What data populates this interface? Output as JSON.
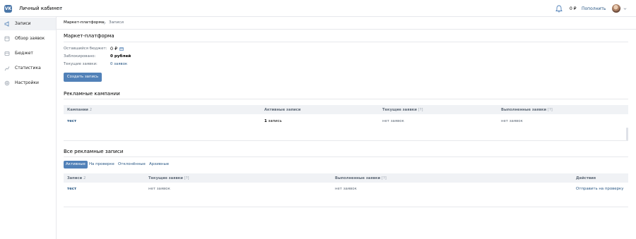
{
  "topbar": {
    "logo_text": "VK",
    "cabinet_label": "Личный кабинет",
    "balance": "0 ₽",
    "topup_label": "Пополнить"
  },
  "sidebar": {
    "items": [
      {
        "label": "Записи",
        "icon": "megaphone-icon",
        "active": true
      },
      {
        "label": "Обзор заявок",
        "icon": "document-icon",
        "active": false
      },
      {
        "label": "Бюджет",
        "icon": "wallet-icon",
        "active": false
      },
      {
        "label": "Статистика",
        "icon": "stats-icon",
        "active": false
      },
      {
        "label": "Настройки",
        "icon": "gear-icon",
        "active": false
      }
    ]
  },
  "breadcrumb": {
    "parent": "Маркет-платформа",
    "current": "Записи"
  },
  "platform": {
    "title": "Маркет-платформа",
    "rows": [
      {
        "label": "Оставшийся бюджет:",
        "value": "0 ₽"
      },
      {
        "label": "Заблокировано:",
        "value": "0 рублей"
      },
      {
        "label": "Текущие заявки:",
        "value": "0 заявок"
      }
    ],
    "create_button": "Создать запись"
  },
  "campaigns": {
    "title": "Рекламные кампании",
    "columns": [
      {
        "label": "Кампании",
        "suffix": "2"
      },
      {
        "label": "Активные записи",
        "suffix": ""
      },
      {
        "label": "Текущие заявки",
        "suffix": "[?]"
      },
      {
        "label": "Выполненные заявки",
        "suffix": "[?]"
      }
    ],
    "rows": [
      {
        "name": "тест",
        "active_count": "1",
        "active_unit": "запись",
        "current": "нет заявок",
        "done": "нет заявок"
      }
    ]
  },
  "posts": {
    "title": "Все рекламные записи",
    "tabs": [
      "Активные",
      "На проверке",
      "Отклонённые",
      "Архивные"
    ],
    "active_tab": "Активные",
    "columns": [
      {
        "label": "Записи",
        "suffix": "2"
      },
      {
        "label": "Текущие заявки",
        "suffix": "[?]"
      },
      {
        "label": "Выполненные заявки",
        "suffix": "[?]"
      },
      {
        "label": "Действия",
        "suffix": ""
      }
    ],
    "rows": [
      {
        "name": "тест",
        "current": "нет заявок",
        "done": "нет заявок",
        "action": "Отправить на проверку"
      }
    ]
  },
  "colors": {
    "accent": "#5181b8",
    "link": "#2a5885",
    "header_bg": "#f0f2f5",
    "border": "#e7e8ec"
  }
}
